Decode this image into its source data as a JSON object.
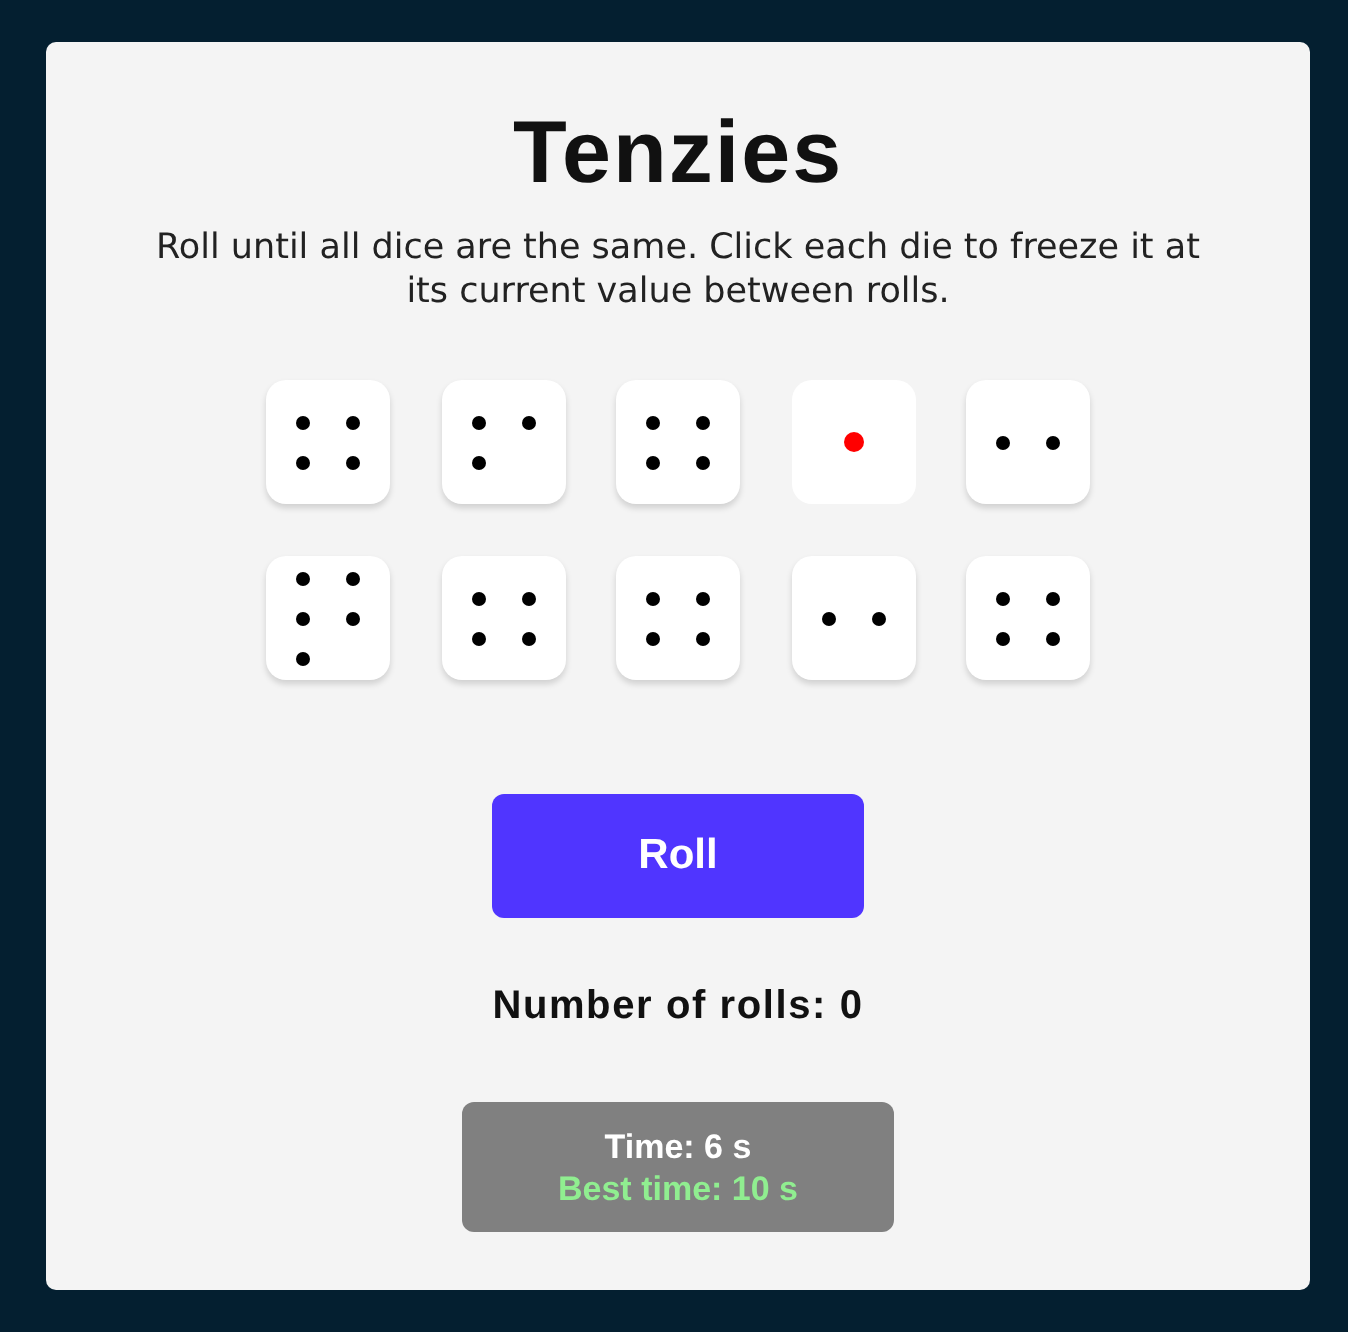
{
  "title": "Tenzies",
  "instructions": "Roll until all dice are the same. Click each die to freeze it at its current value between rolls.",
  "dice": [
    {
      "kind": "four",
      "held": false
    },
    {
      "kind": "three",
      "held": false
    },
    {
      "kind": "four",
      "held": false
    },
    {
      "kind": "one",
      "held": true
    },
    {
      "kind": "two",
      "held": false
    },
    {
      "kind": "five",
      "held": false
    },
    {
      "kind": "four",
      "held": false
    },
    {
      "kind": "four",
      "held": false
    },
    {
      "kind": "two",
      "held": false
    },
    {
      "kind": "four",
      "held": false
    }
  ],
  "roll_button": {
    "label": "Roll"
  },
  "roll_count": "Number of rolls: 0",
  "timer": {
    "time": "Time: 6 s",
    "best_time": "Best time: 10 s"
  }
}
